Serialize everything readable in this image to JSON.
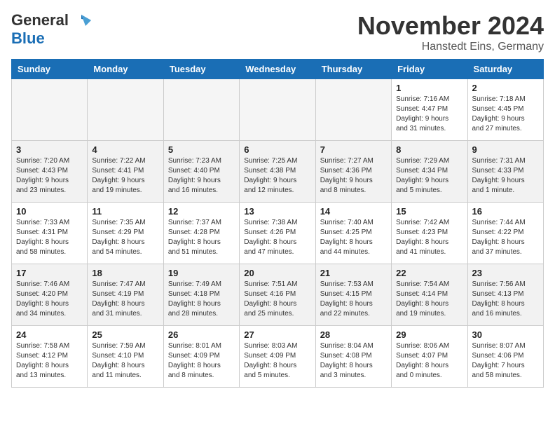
{
  "header": {
    "logo_general": "General",
    "logo_blue": "Blue",
    "month_title": "November 2024",
    "location": "Hanstedt Eins, Germany"
  },
  "days_of_week": [
    "Sunday",
    "Monday",
    "Tuesday",
    "Wednesday",
    "Thursday",
    "Friday",
    "Saturday"
  ],
  "weeks": [
    {
      "days": [
        {
          "date": "",
          "info": ""
        },
        {
          "date": "",
          "info": ""
        },
        {
          "date": "",
          "info": ""
        },
        {
          "date": "",
          "info": ""
        },
        {
          "date": "",
          "info": ""
        },
        {
          "date": "1",
          "info": "Sunrise: 7:16 AM\nSunset: 4:47 PM\nDaylight: 9 hours\nand 31 minutes."
        },
        {
          "date": "2",
          "info": "Sunrise: 7:18 AM\nSunset: 4:45 PM\nDaylight: 9 hours\nand 27 minutes."
        }
      ]
    },
    {
      "days": [
        {
          "date": "3",
          "info": "Sunrise: 7:20 AM\nSunset: 4:43 PM\nDaylight: 9 hours\nand 23 minutes."
        },
        {
          "date": "4",
          "info": "Sunrise: 7:22 AM\nSunset: 4:41 PM\nDaylight: 9 hours\nand 19 minutes."
        },
        {
          "date": "5",
          "info": "Sunrise: 7:23 AM\nSunset: 4:40 PM\nDaylight: 9 hours\nand 16 minutes."
        },
        {
          "date": "6",
          "info": "Sunrise: 7:25 AM\nSunset: 4:38 PM\nDaylight: 9 hours\nand 12 minutes."
        },
        {
          "date": "7",
          "info": "Sunrise: 7:27 AM\nSunset: 4:36 PM\nDaylight: 9 hours\nand 8 minutes."
        },
        {
          "date": "8",
          "info": "Sunrise: 7:29 AM\nSunset: 4:34 PM\nDaylight: 9 hours\nand 5 minutes."
        },
        {
          "date": "9",
          "info": "Sunrise: 7:31 AM\nSunset: 4:33 PM\nDaylight: 9 hours\nand 1 minute."
        }
      ]
    },
    {
      "days": [
        {
          "date": "10",
          "info": "Sunrise: 7:33 AM\nSunset: 4:31 PM\nDaylight: 8 hours\nand 58 minutes."
        },
        {
          "date": "11",
          "info": "Sunrise: 7:35 AM\nSunset: 4:29 PM\nDaylight: 8 hours\nand 54 minutes."
        },
        {
          "date": "12",
          "info": "Sunrise: 7:37 AM\nSunset: 4:28 PM\nDaylight: 8 hours\nand 51 minutes."
        },
        {
          "date": "13",
          "info": "Sunrise: 7:38 AM\nSunset: 4:26 PM\nDaylight: 8 hours\nand 47 minutes."
        },
        {
          "date": "14",
          "info": "Sunrise: 7:40 AM\nSunset: 4:25 PM\nDaylight: 8 hours\nand 44 minutes."
        },
        {
          "date": "15",
          "info": "Sunrise: 7:42 AM\nSunset: 4:23 PM\nDaylight: 8 hours\nand 41 minutes."
        },
        {
          "date": "16",
          "info": "Sunrise: 7:44 AM\nSunset: 4:22 PM\nDaylight: 8 hours\nand 37 minutes."
        }
      ]
    },
    {
      "days": [
        {
          "date": "17",
          "info": "Sunrise: 7:46 AM\nSunset: 4:20 PM\nDaylight: 8 hours\nand 34 minutes."
        },
        {
          "date": "18",
          "info": "Sunrise: 7:47 AM\nSunset: 4:19 PM\nDaylight: 8 hours\nand 31 minutes."
        },
        {
          "date": "19",
          "info": "Sunrise: 7:49 AM\nSunset: 4:18 PM\nDaylight: 8 hours\nand 28 minutes."
        },
        {
          "date": "20",
          "info": "Sunrise: 7:51 AM\nSunset: 4:16 PM\nDaylight: 8 hours\nand 25 minutes."
        },
        {
          "date": "21",
          "info": "Sunrise: 7:53 AM\nSunset: 4:15 PM\nDaylight: 8 hours\nand 22 minutes."
        },
        {
          "date": "22",
          "info": "Sunrise: 7:54 AM\nSunset: 4:14 PM\nDaylight: 8 hours\nand 19 minutes."
        },
        {
          "date": "23",
          "info": "Sunrise: 7:56 AM\nSunset: 4:13 PM\nDaylight: 8 hours\nand 16 minutes."
        }
      ]
    },
    {
      "days": [
        {
          "date": "24",
          "info": "Sunrise: 7:58 AM\nSunset: 4:12 PM\nDaylight: 8 hours\nand 13 minutes."
        },
        {
          "date": "25",
          "info": "Sunrise: 7:59 AM\nSunset: 4:10 PM\nDaylight: 8 hours\nand 11 minutes."
        },
        {
          "date": "26",
          "info": "Sunrise: 8:01 AM\nSunset: 4:09 PM\nDaylight: 8 hours\nand 8 minutes."
        },
        {
          "date": "27",
          "info": "Sunrise: 8:03 AM\nSunset: 4:09 PM\nDaylight: 8 hours\nand 5 minutes."
        },
        {
          "date": "28",
          "info": "Sunrise: 8:04 AM\nSunset: 4:08 PM\nDaylight: 8 hours\nand 3 minutes."
        },
        {
          "date": "29",
          "info": "Sunrise: 8:06 AM\nSunset: 4:07 PM\nDaylight: 8 hours\nand 0 minutes."
        },
        {
          "date": "30",
          "info": "Sunrise: 8:07 AM\nSunset: 4:06 PM\nDaylight: 7 hours\nand 58 minutes."
        }
      ]
    }
  ]
}
